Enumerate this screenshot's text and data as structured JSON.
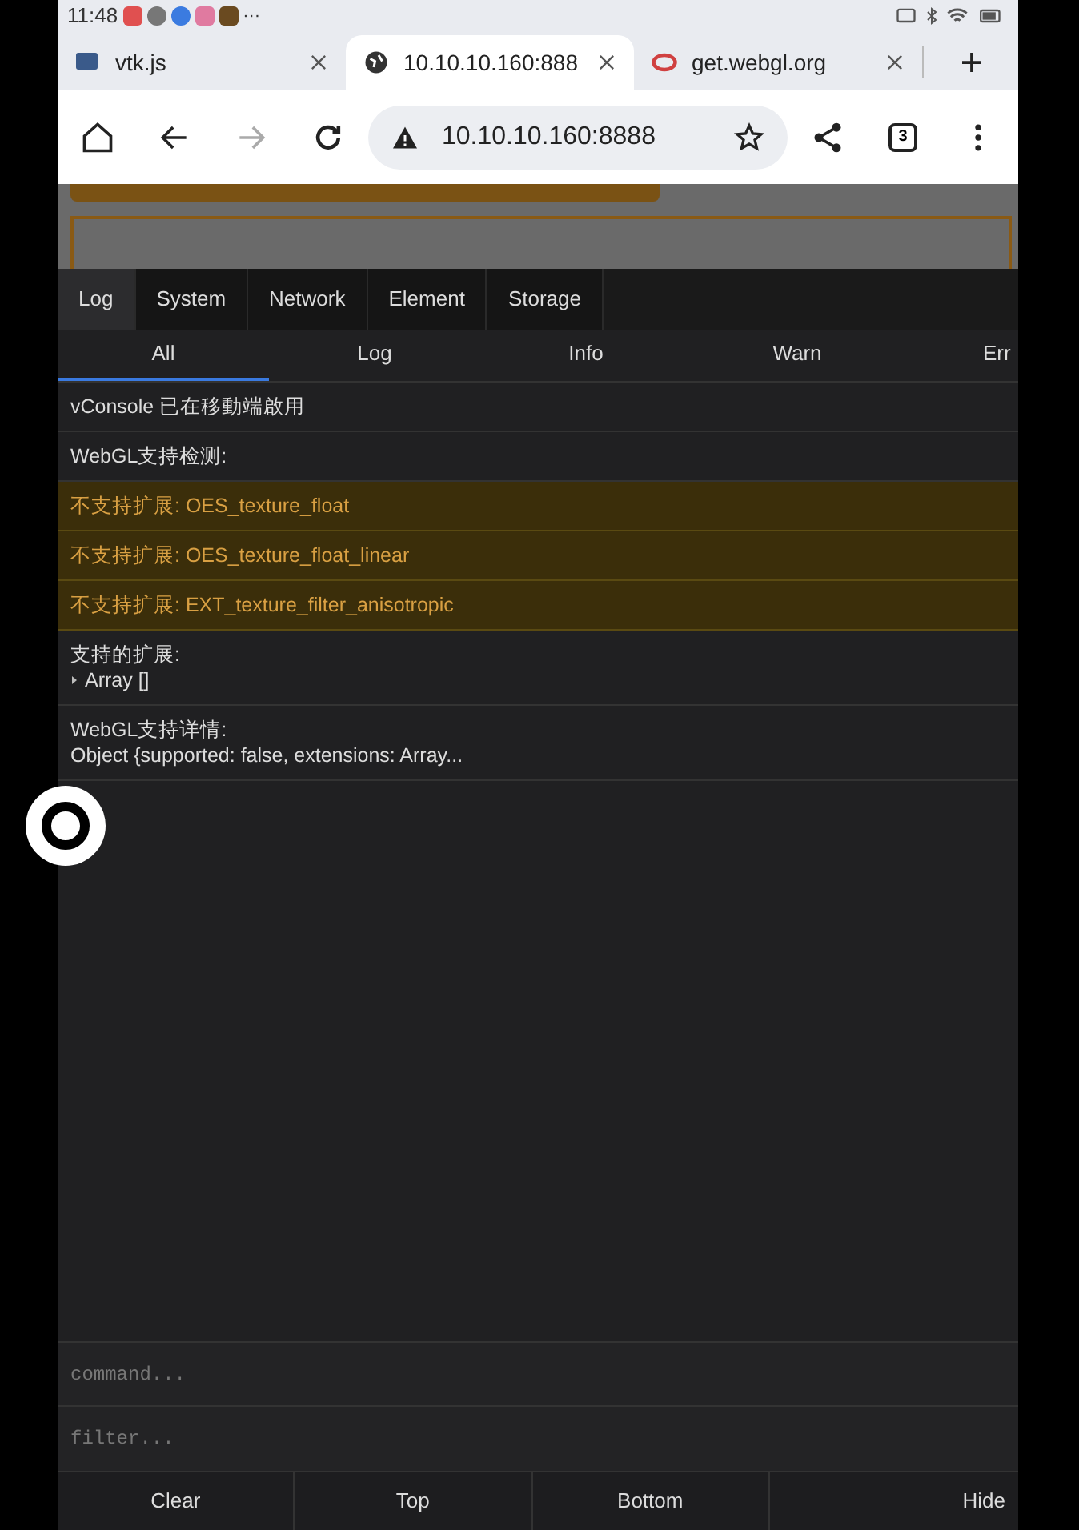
{
  "status_bar": {
    "time": "11:48",
    "more": "···"
  },
  "browser_tabs": [
    {
      "title": "vtk.js",
      "selected": false
    },
    {
      "title": "10.10.10.160:888",
      "selected": true
    },
    {
      "title": "get.webgl.org",
      "selected": false
    }
  ],
  "toolbar": {
    "url": "10.10.10.160:8888",
    "tab_count": "3"
  },
  "vconsole": {
    "tabs": [
      {
        "label": "Log",
        "selected": true
      },
      {
        "label": "System",
        "selected": false
      },
      {
        "label": "Network",
        "selected": false
      },
      {
        "label": "Element",
        "selected": false
      },
      {
        "label": "Storage",
        "selected": false
      }
    ],
    "filters": [
      {
        "label": "All",
        "selected": true
      },
      {
        "label": "Log",
        "selected": false
      },
      {
        "label": "Info",
        "selected": false
      },
      {
        "label": "Warn",
        "selected": false
      },
      {
        "label": "Err",
        "selected": false
      }
    ],
    "entries": [
      {
        "kind": "log",
        "lines": [
          "vConsole 已在移動端啟用"
        ]
      },
      {
        "kind": "log",
        "lines": [
          "WebGL支持检测:"
        ]
      },
      {
        "kind": "warn",
        "lines": [
          "不支持扩展: OES_texture_float"
        ]
      },
      {
        "kind": "warn",
        "lines": [
          "不支持扩展: OES_texture_float_linear"
        ]
      },
      {
        "kind": "warn",
        "lines": [
          "不支持扩展: EXT_texture_filter_anisotropic"
        ]
      },
      {
        "kind": "log",
        "lines": [
          "支持的扩展:"
        ],
        "object": "Array []"
      },
      {
        "kind": "log",
        "lines": [
          "WebGL支持详情:",
          "Object {supported: false, extensions: Array..."
        ]
      }
    ],
    "command": {
      "placeholder": "command..."
    },
    "filter": {
      "placeholder": "filter..."
    },
    "buttons": [
      "Clear",
      "Top",
      "Bottom",
      "Hide"
    ]
  }
}
